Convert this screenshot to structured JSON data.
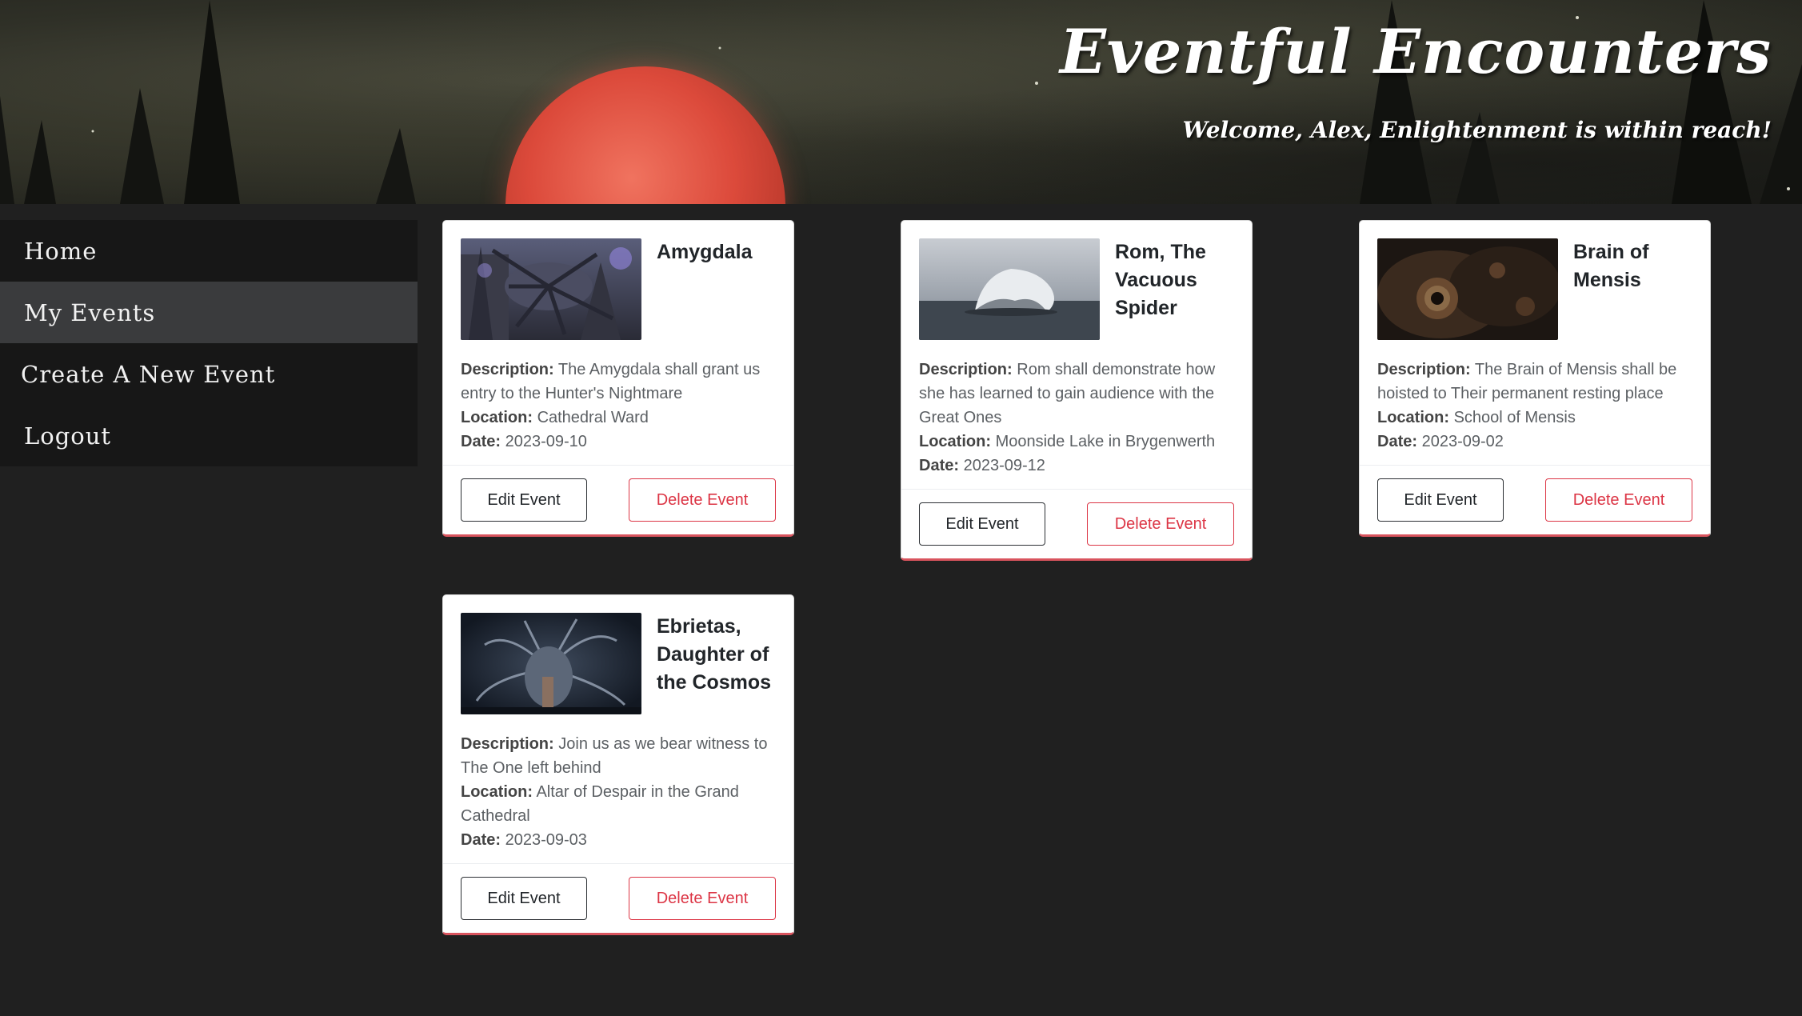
{
  "header": {
    "title": "Eventful Encounters",
    "welcome": "Welcome, Alex, Enlightenment is within reach!"
  },
  "sidebar": {
    "items": [
      {
        "label": "Home",
        "active": false
      },
      {
        "label": "My Events",
        "active": true
      },
      {
        "label": "Create A New Event",
        "active": false
      },
      {
        "label": "Logout",
        "active": false
      }
    ]
  },
  "labels": {
    "description": "Description:",
    "location": "Location:",
    "date": "Date:",
    "edit": "Edit Event",
    "delete": "Delete Event"
  },
  "events": [
    {
      "title": "Amygdala",
      "description": "The Amygdala shall grant us entry to the Hunter's Nightmare",
      "location": "Cathedral Ward",
      "date": "2023-09-10",
      "thumbnail_icon": "amygdala-image"
    },
    {
      "title": "Rom, The Vacuous Spider",
      "description": "Rom shall demonstrate how she has learned to gain audience with the Great Ones",
      "location": "Moonside Lake in Brygenwerth",
      "date": "2023-09-12",
      "thumbnail_icon": "rom-image"
    },
    {
      "title": "Brain of Mensis",
      "description": "The Brain of Mensis shall be hoisted to Their permanent resting place",
      "location": "School of Mensis",
      "date": "2023-09-02",
      "thumbnail_icon": "brain-of-mensis-image"
    },
    {
      "title": "Ebrietas, Daughter of the Cosmos",
      "description": "Join us as we bear witness to The One left behind",
      "location": "Altar of Despair in the Grand Cathedral",
      "date": "2023-09-03",
      "thumbnail_icon": "ebrietas-image"
    }
  ],
  "colors": {
    "page_bg": "#202020",
    "sidebar_bg": "#171717",
    "active_nav_bg": "#3a3b3d",
    "delete_red": "#dc3545",
    "moon_red": "#dc4a3b"
  }
}
